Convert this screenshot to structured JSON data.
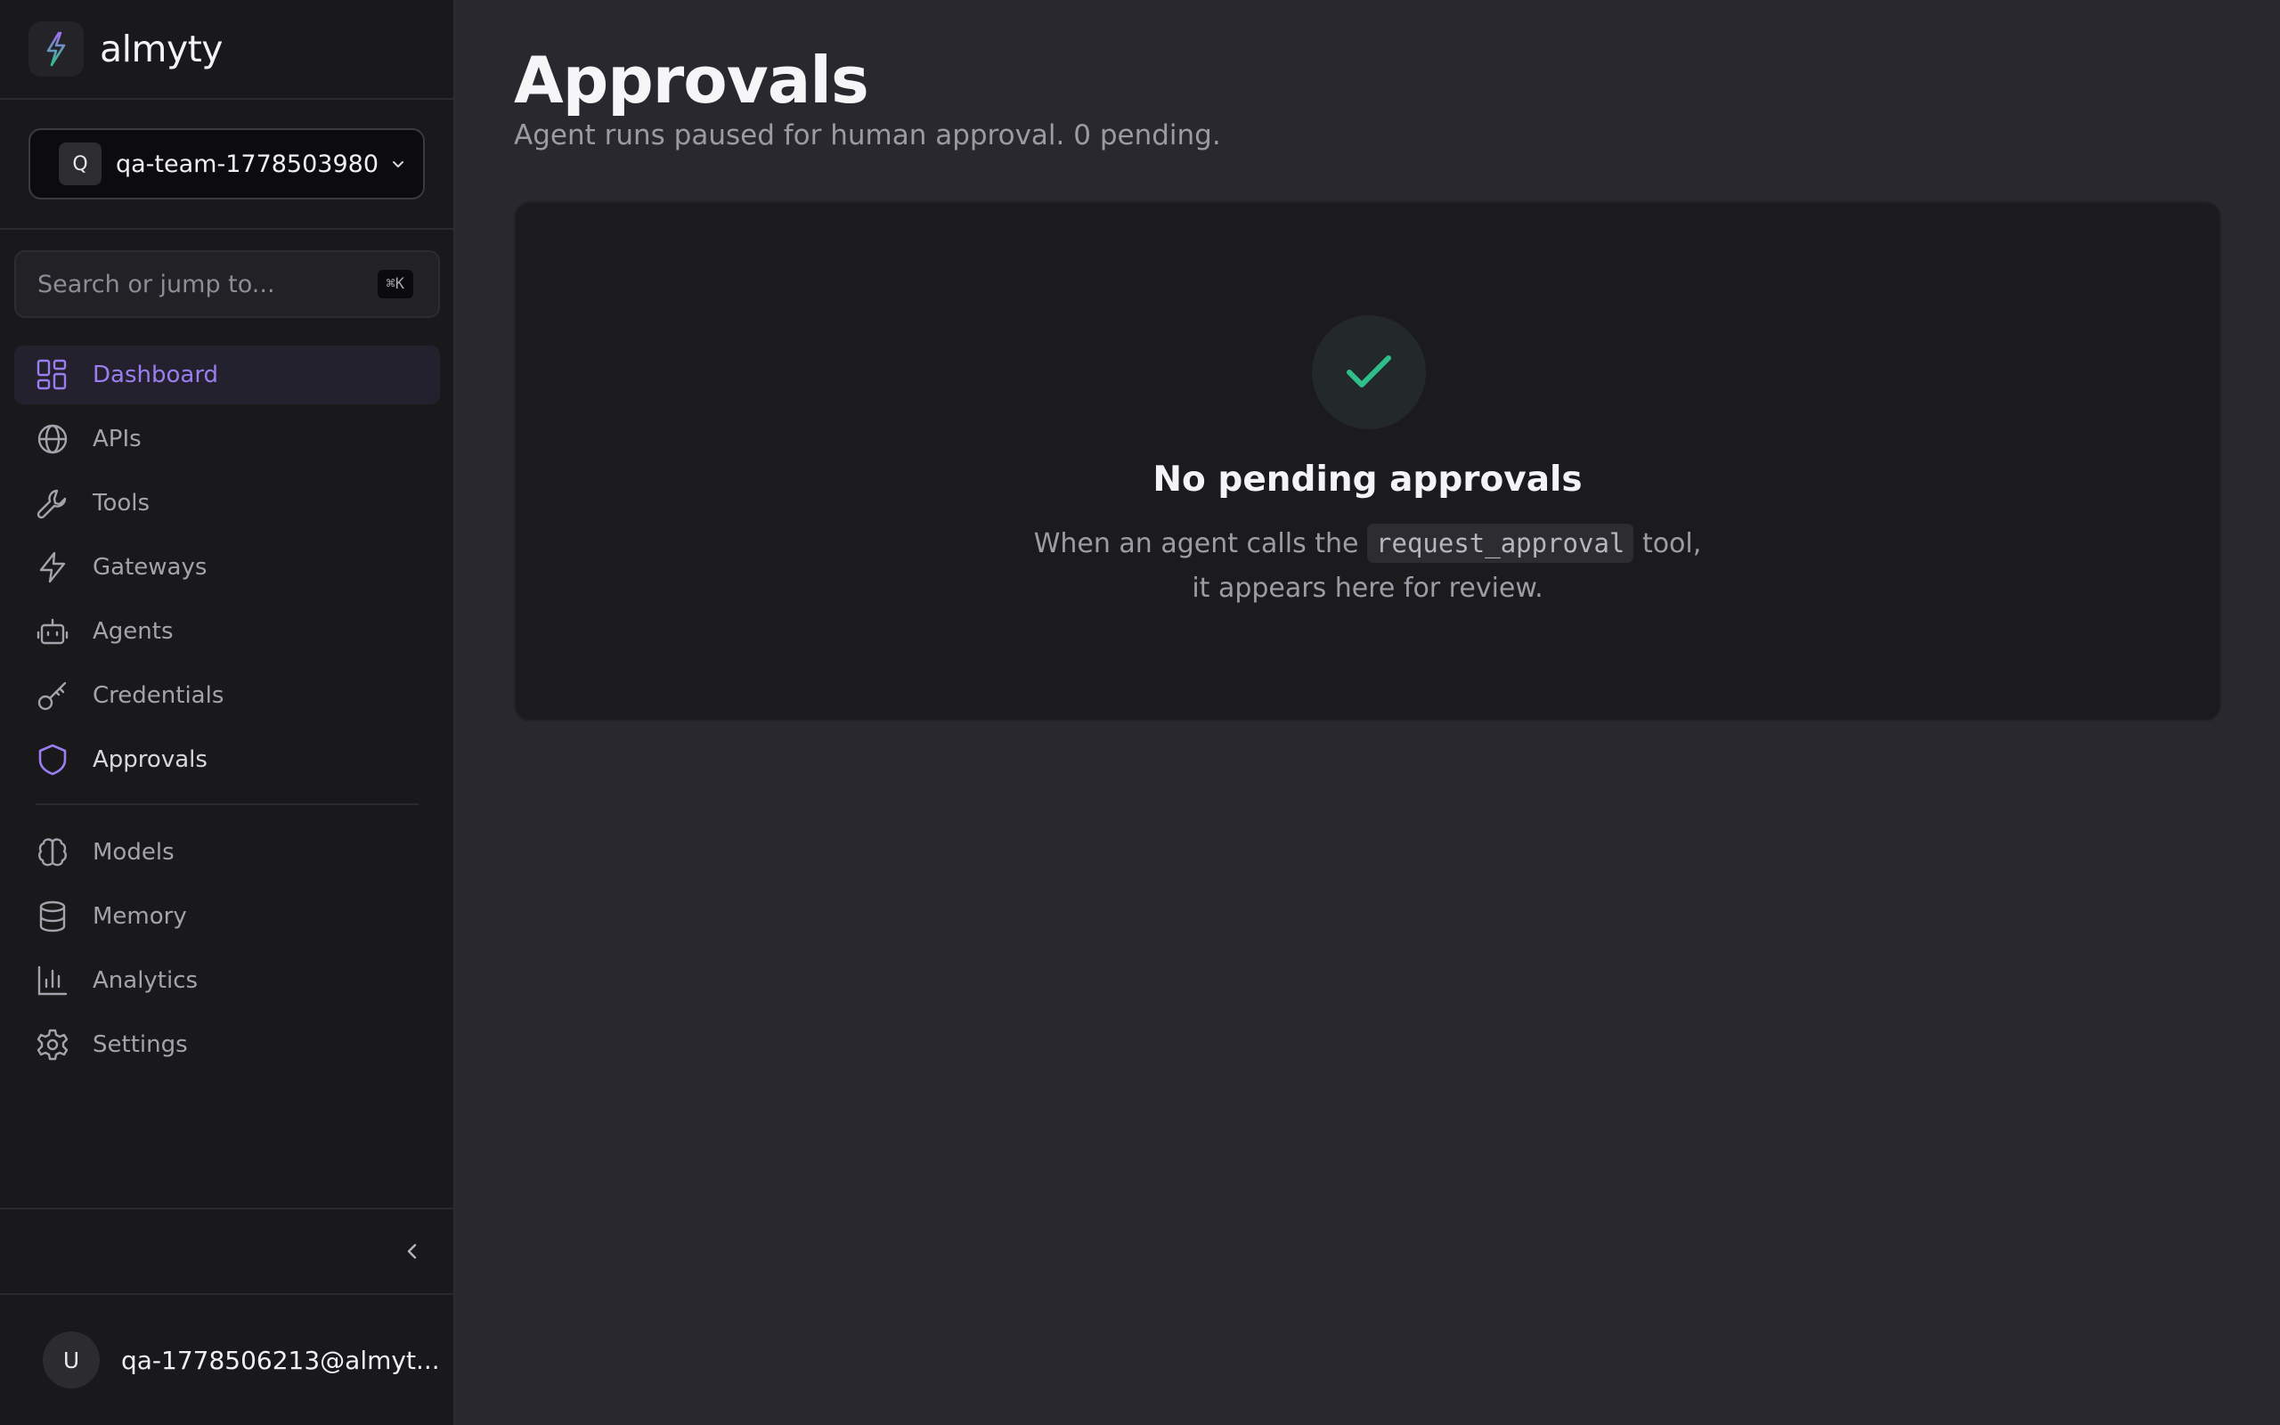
{
  "brand": {
    "name": "almyty"
  },
  "team": {
    "avatar": "Q",
    "name": "qa-team-1778503980"
  },
  "search": {
    "placeholder": "Search or jump to...",
    "shortcut": "⌘K"
  },
  "nav": {
    "primary": [
      {
        "label": "Dashboard",
        "icon": "dashboard-icon",
        "active": true
      },
      {
        "label": "APIs",
        "icon": "globe-icon"
      },
      {
        "label": "Tools",
        "icon": "wrench-icon"
      },
      {
        "label": "Gateways",
        "icon": "bolt-icon"
      },
      {
        "label": "Agents",
        "icon": "robot-icon"
      },
      {
        "label": "Credentials",
        "icon": "key-icon"
      },
      {
        "label": "Approvals",
        "icon": "shield-icon"
      }
    ],
    "secondary": [
      {
        "label": "Models",
        "icon": "brain-icon"
      },
      {
        "label": "Memory",
        "icon": "database-icon"
      },
      {
        "label": "Analytics",
        "icon": "bar-chart-icon"
      },
      {
        "label": "Settings",
        "icon": "gear-icon"
      }
    ]
  },
  "user": {
    "avatar": "U",
    "email": "qa-1778506213@almyt..."
  },
  "page": {
    "title": "Approvals",
    "subtitle": "Agent runs paused for human approval. 0 pending."
  },
  "empty_state": {
    "title": "No pending approvals",
    "desc_before": "When an agent calls the",
    "code": "request_approval",
    "desc_after": "tool, it appears here for review."
  },
  "colors": {
    "accent": "#9a7ef0",
    "success": "#2fbf8a",
    "sidebar_bg": "#19191c",
    "main_bg": "#29282f"
  }
}
